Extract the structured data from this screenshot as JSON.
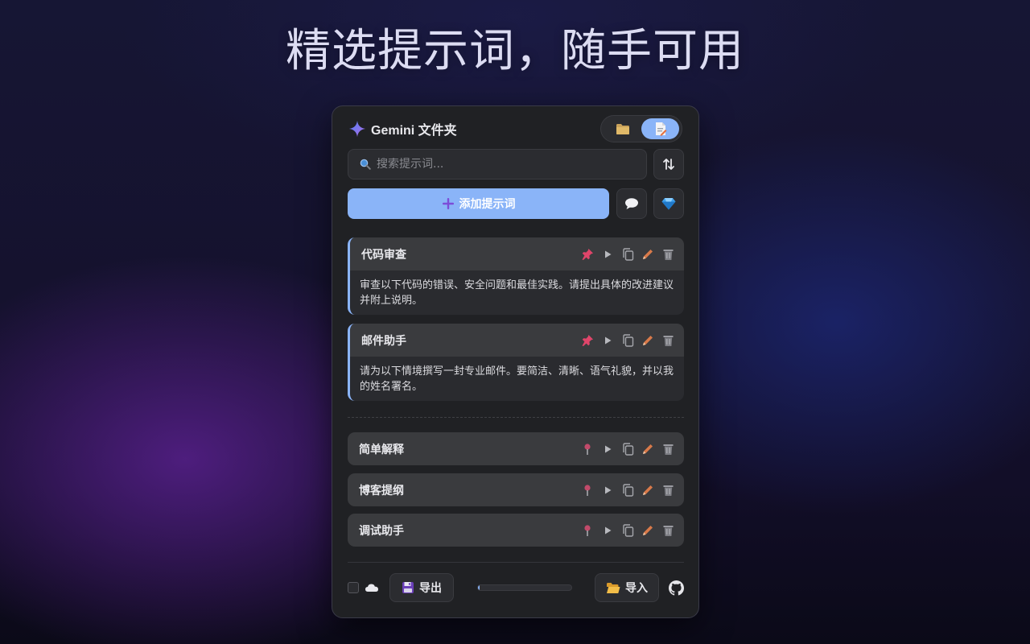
{
  "hero": {
    "title": "精选提示词，随手可用"
  },
  "panel": {
    "title": "Gemini 文件夹",
    "mode_switch": {
      "options": [
        "folder-icon",
        "prompt-icon"
      ],
      "active": "prompt-icon"
    },
    "search": {
      "placeholder": "搜索提示词...",
      "value": ""
    },
    "sort_icon": "sort-icon",
    "add_button": {
      "label": "添加提示词"
    },
    "chat_icon": "speech-bubble-icon",
    "gem_icon": "gem-icon",
    "pinned_prompts": [
      {
        "title": "代码审查",
        "body": "审查以下代码的错误、安全问题和最佳实践。请提出具体的改进建议并附上说明。"
      },
      {
        "title": "邮件助手",
        "body": "请为以下情境撰写一封专业邮件。要简洁、清晰、语气礼貌，并以我的姓名署名。"
      }
    ],
    "prompts": [
      {
        "title": "简单解释"
      },
      {
        "title": "博客提纲"
      },
      {
        "title": "调试助手"
      }
    ],
    "footer": {
      "export_label": "导出",
      "import_label": "导入",
      "sync_progress": 0.02
    }
  },
  "colors": {
    "accent": "#8ab4f8",
    "pin_active": "#e0456a",
    "edit": "#d97a4a",
    "panel_bg": "#202124"
  }
}
